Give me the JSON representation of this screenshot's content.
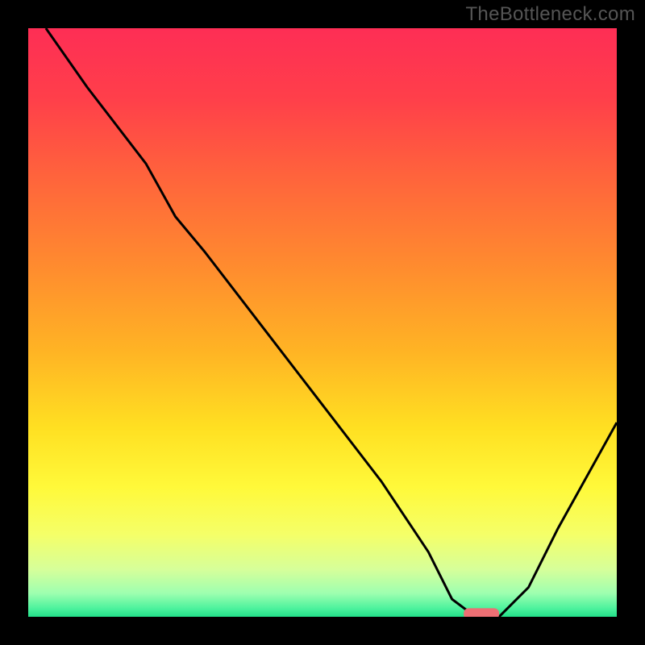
{
  "watermark": "TheBottleneck.com",
  "chart_data": {
    "type": "line",
    "title": "",
    "xlabel": "",
    "ylabel": "",
    "xlim": [
      0,
      100
    ],
    "ylim": [
      0,
      100
    ],
    "series": [
      {
        "name": "curve",
        "x": [
          3,
          10,
          20,
          25,
          30,
          40,
          50,
          60,
          68,
          72,
          76,
          80,
          85,
          90,
          100
        ],
        "y": [
          100,
          90,
          77,
          68,
          62,
          49,
          36,
          23,
          11,
          3,
          0,
          0,
          5,
          15,
          33
        ]
      }
    ],
    "marker": {
      "x": 77,
      "y": 0.5,
      "width": 6,
      "color": "#ed6f74"
    },
    "gradient_stops": [
      {
        "pos": 0.0,
        "color": "#fe2e55"
      },
      {
        "pos": 0.12,
        "color": "#ff3f4a"
      },
      {
        "pos": 0.25,
        "color": "#ff633c"
      },
      {
        "pos": 0.4,
        "color": "#ff8a2f"
      },
      {
        "pos": 0.55,
        "color": "#ffb424"
      },
      {
        "pos": 0.68,
        "color": "#ffe022"
      },
      {
        "pos": 0.78,
        "color": "#fff93a"
      },
      {
        "pos": 0.86,
        "color": "#f5ff68"
      },
      {
        "pos": 0.92,
        "color": "#d6ff9a"
      },
      {
        "pos": 0.96,
        "color": "#9effb0"
      },
      {
        "pos": 0.985,
        "color": "#4ff39e"
      },
      {
        "pos": 1.0,
        "color": "#23e08a"
      }
    ]
  }
}
